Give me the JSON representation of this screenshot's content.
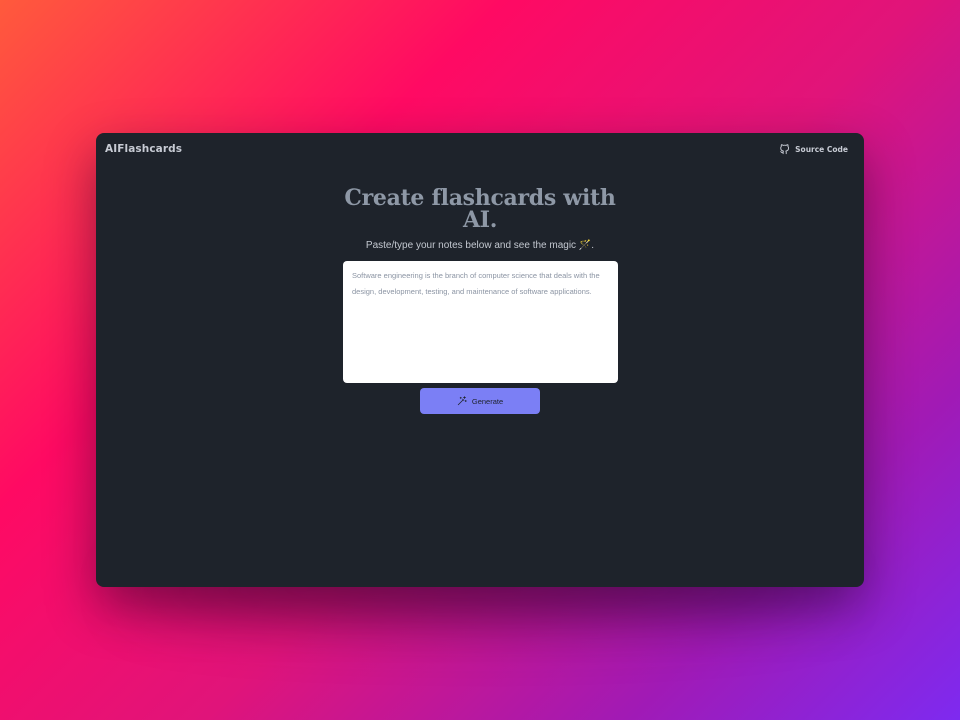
{
  "app": {
    "brand": "AIFlashcards"
  },
  "header": {
    "source_link_label": "Source Code",
    "source_icon": "github-icon"
  },
  "hero": {
    "title_line1": "Create flashcards with",
    "title_line2": "AI.",
    "subtitle": "Paste/type your notes below and see the magic 🪄."
  },
  "notes": {
    "placeholder": "Software engineering is the branch of computer science that deals with the design, development, testing, and maintenance of software applications.",
    "value": ""
  },
  "actions": {
    "generate_label": "Generate",
    "generate_icon": "magic-wand-icon"
  },
  "colors": {
    "window_bg": "#1e232b",
    "accent": "#7b7ff5",
    "title": "#8e98a6"
  }
}
